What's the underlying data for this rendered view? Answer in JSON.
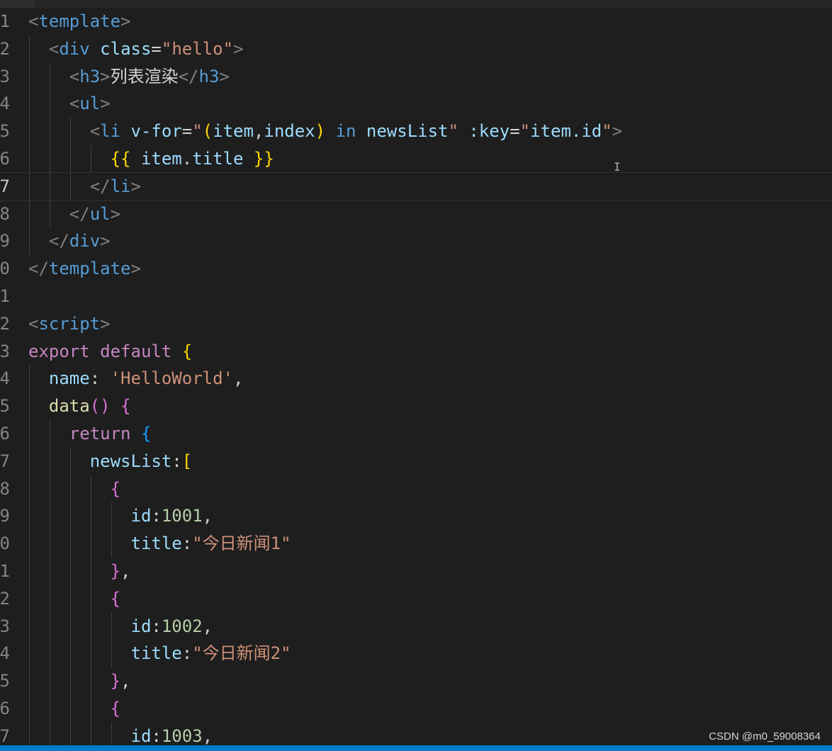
{
  "editor": {
    "colors": {
      "background": "#1e1e1e",
      "tag_bracket": "#808080",
      "tag_name": "#569cd6",
      "attribute": "#9cdcfe",
      "string": "#ce9178",
      "keyword_control": "#c586c0",
      "keyword": "#569cd6",
      "function": "#dcdcaa",
      "number": "#b5cea8",
      "brace_gold": "#ffd700",
      "brace_purple": "#da70d6",
      "brace_blue": "#179fff",
      "status_bar": "#007acc"
    },
    "lines": [
      {
        "number": "1",
        "tokens": [
          {
            "t": "<",
            "c": "tag_bracket"
          },
          {
            "t": "template",
            "c": "tag_name"
          },
          {
            "t": ">",
            "c": "tag_bracket"
          }
        ]
      },
      {
        "number": "2",
        "tokens": [
          {
            "t": "  "
          },
          {
            "t": "<",
            "c": "tag_bracket"
          },
          {
            "t": "div",
            "c": "tag_name"
          },
          {
            "t": " "
          },
          {
            "t": "class",
            "c": "attribute"
          },
          {
            "t": "=",
            "c": "default"
          },
          {
            "t": "\"hello\"",
            "c": "string"
          },
          {
            "t": ">",
            "c": "tag_bracket"
          }
        ]
      },
      {
        "number": "3",
        "tokens": [
          {
            "t": "    "
          },
          {
            "t": "<",
            "c": "tag_bracket"
          },
          {
            "t": "h3",
            "c": "tag_name"
          },
          {
            "t": ">",
            "c": "tag_bracket"
          },
          {
            "t": "列表渲染",
            "c": "default"
          },
          {
            "t": "</",
            "c": "tag_bracket"
          },
          {
            "t": "h3",
            "c": "tag_name"
          },
          {
            "t": ">",
            "c": "tag_bracket"
          }
        ]
      },
      {
        "number": "4",
        "tokens": [
          {
            "t": "    "
          },
          {
            "t": "<",
            "c": "tag_bracket"
          },
          {
            "t": "ul",
            "c": "tag_name"
          },
          {
            "t": ">",
            "c": "tag_bracket"
          }
        ]
      },
      {
        "number": "5",
        "tokens": [
          {
            "t": "      "
          },
          {
            "t": "<",
            "c": "tag_bracket"
          },
          {
            "t": "li",
            "c": "tag_name"
          },
          {
            "t": " "
          },
          {
            "t": "v-for",
            "c": "attribute"
          },
          {
            "t": "=",
            "c": "default"
          },
          {
            "t": "\"",
            "c": "string"
          },
          {
            "t": "(",
            "c": "brace_gold"
          },
          {
            "t": "item",
            "c": "attribute"
          },
          {
            "t": ",",
            "c": "default"
          },
          {
            "t": "index",
            "c": "attribute"
          },
          {
            "t": ")",
            "c": "brace_gold"
          },
          {
            "t": " "
          },
          {
            "t": "in",
            "c": "keyword"
          },
          {
            "t": " "
          },
          {
            "t": "newsList",
            "c": "attribute"
          },
          {
            "t": "\"",
            "c": "string"
          },
          {
            "t": " "
          },
          {
            "t": ":key",
            "c": "attribute"
          },
          {
            "t": "=",
            "c": "default"
          },
          {
            "t": "\"",
            "c": "string"
          },
          {
            "t": "item.id",
            "c": "attribute"
          },
          {
            "t": "\"",
            "c": "string"
          },
          {
            "t": ">",
            "c": "tag_bracket"
          }
        ]
      },
      {
        "number": "6",
        "tokens": [
          {
            "t": "        "
          },
          {
            "t": "{{",
            "c": "brace_gold"
          },
          {
            "t": " "
          },
          {
            "t": "item",
            "c": "attribute"
          },
          {
            "t": ".",
            "c": "default"
          },
          {
            "t": "title",
            "c": "attribute"
          },
          {
            "t": " "
          },
          {
            "t": "}}",
            "c": "brace_gold"
          }
        ]
      },
      {
        "number": "7",
        "active": true,
        "tokens": [
          {
            "t": "      "
          },
          {
            "t": "</",
            "c": "tag_bracket"
          },
          {
            "t": "li",
            "c": "tag_name"
          },
          {
            "t": ">",
            "c": "tag_bracket"
          }
        ]
      },
      {
        "number": "8",
        "tokens": [
          {
            "t": "    "
          },
          {
            "t": "</",
            "c": "tag_bracket"
          },
          {
            "t": "ul",
            "c": "tag_name"
          },
          {
            "t": ">",
            "c": "tag_bracket"
          }
        ]
      },
      {
        "number": "9",
        "tokens": [
          {
            "t": "  "
          },
          {
            "t": "</",
            "c": "tag_bracket"
          },
          {
            "t": "div",
            "c": "tag_name"
          },
          {
            "t": ">",
            "c": "tag_bracket"
          }
        ]
      },
      {
        "number": "0",
        "tokens": [
          {
            "t": "</",
            "c": "tag_bracket"
          },
          {
            "t": "template",
            "c": "tag_name"
          },
          {
            "t": ">",
            "c": "tag_bracket"
          }
        ]
      },
      {
        "number": "1",
        "tokens": []
      },
      {
        "number": "2",
        "tokens": [
          {
            "t": "<",
            "c": "tag_bracket"
          },
          {
            "t": "script",
            "c": "tag_name"
          },
          {
            "t": ">",
            "c": "tag_bracket"
          }
        ]
      },
      {
        "number": "3",
        "tokens": [
          {
            "t": "export",
            "c": "keyword_control"
          },
          {
            "t": " "
          },
          {
            "t": "default",
            "c": "keyword_control"
          },
          {
            "t": " "
          },
          {
            "t": "{",
            "c": "brace_gold"
          }
        ]
      },
      {
        "number": "4",
        "tokens": [
          {
            "t": "  "
          },
          {
            "t": "name",
            "c": "attribute"
          },
          {
            "t": ": ",
            "c": "default"
          },
          {
            "t": "'HelloWorld'",
            "c": "string"
          },
          {
            "t": ",",
            "c": "default"
          }
        ]
      },
      {
        "number": "5",
        "tokens": [
          {
            "t": "  "
          },
          {
            "t": "data",
            "c": "function"
          },
          {
            "t": "()",
            "c": "brace_purple"
          },
          {
            "t": " "
          },
          {
            "t": "{",
            "c": "brace_purple"
          }
        ]
      },
      {
        "number": "6",
        "tokens": [
          {
            "t": "    "
          },
          {
            "t": "return",
            "c": "keyword_control"
          },
          {
            "t": " "
          },
          {
            "t": "{",
            "c": "brace_blue"
          }
        ]
      },
      {
        "number": "7",
        "tokens": [
          {
            "t": "      "
          },
          {
            "t": "newsList",
            "c": "attribute"
          },
          {
            "t": ":",
            "c": "default"
          },
          {
            "t": "[",
            "c": "brace_gold"
          }
        ]
      },
      {
        "number": "8",
        "tokens": [
          {
            "t": "        "
          },
          {
            "t": "{",
            "c": "brace_purple"
          }
        ]
      },
      {
        "number": "9",
        "tokens": [
          {
            "t": "          "
          },
          {
            "t": "id",
            "c": "attribute"
          },
          {
            "t": ":",
            "c": "default"
          },
          {
            "t": "1001",
            "c": "number"
          },
          {
            "t": ",",
            "c": "default"
          }
        ]
      },
      {
        "number": "0",
        "tokens": [
          {
            "t": "          "
          },
          {
            "t": "title",
            "c": "attribute"
          },
          {
            "t": ":",
            "c": "default"
          },
          {
            "t": "\"今日新闻1\"",
            "c": "string"
          }
        ]
      },
      {
        "number": "1",
        "tokens": [
          {
            "t": "        "
          },
          {
            "t": "}",
            "c": "brace_purple"
          },
          {
            "t": ",",
            "c": "default"
          }
        ]
      },
      {
        "number": "2",
        "tokens": [
          {
            "t": "        "
          },
          {
            "t": "{",
            "c": "brace_purple"
          }
        ]
      },
      {
        "number": "3",
        "tokens": [
          {
            "t": "          "
          },
          {
            "t": "id",
            "c": "attribute"
          },
          {
            "t": ":",
            "c": "default"
          },
          {
            "t": "1002",
            "c": "number"
          },
          {
            "t": ",",
            "c": "default"
          }
        ]
      },
      {
        "number": "4",
        "tokens": [
          {
            "t": "          "
          },
          {
            "t": "title",
            "c": "attribute"
          },
          {
            "t": ":",
            "c": "default"
          },
          {
            "t": "\"今日新闻2\"",
            "c": "string"
          }
        ]
      },
      {
        "number": "5",
        "tokens": [
          {
            "t": "        "
          },
          {
            "t": "}",
            "c": "brace_purple"
          },
          {
            "t": ",",
            "c": "default"
          }
        ]
      },
      {
        "number": "6",
        "tokens": [
          {
            "t": "        "
          },
          {
            "t": "{",
            "c": "brace_purple"
          }
        ]
      },
      {
        "number": "7",
        "tokens": [
          {
            "t": "          "
          },
          {
            "t": "id",
            "c": "attribute"
          },
          {
            "t": ":",
            "c": "default"
          },
          {
            "t": "1003",
            "c": "number"
          },
          {
            "t": ",",
            "c": "default"
          }
        ]
      }
    ]
  },
  "cursor_glyph": "I",
  "watermark": "CSDN @m0_59008364"
}
